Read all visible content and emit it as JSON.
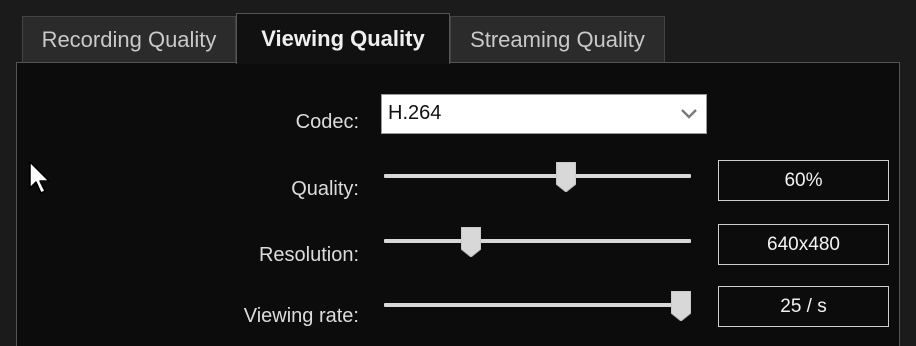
{
  "tabs": [
    {
      "label": "Recording Quality",
      "active": false
    },
    {
      "label": "Viewing Quality",
      "active": true
    },
    {
      "label": "Streaming Quality",
      "active": false
    }
  ],
  "codec": {
    "label": "Codec:",
    "value": "H.264"
  },
  "quality": {
    "label": "Quality:",
    "value_text": "60%",
    "slider_fraction": 0.6
  },
  "resolution": {
    "label": "Resolution:",
    "value_text": "640x480",
    "slider_fraction": 0.27
  },
  "viewing_rate": {
    "label": "Viewing rate:",
    "value_text": "25 / s",
    "slider_fraction": 1.0
  },
  "icons": {
    "dropdown": "chevron-down-icon",
    "pointer": "mouse-pointer-icon"
  }
}
